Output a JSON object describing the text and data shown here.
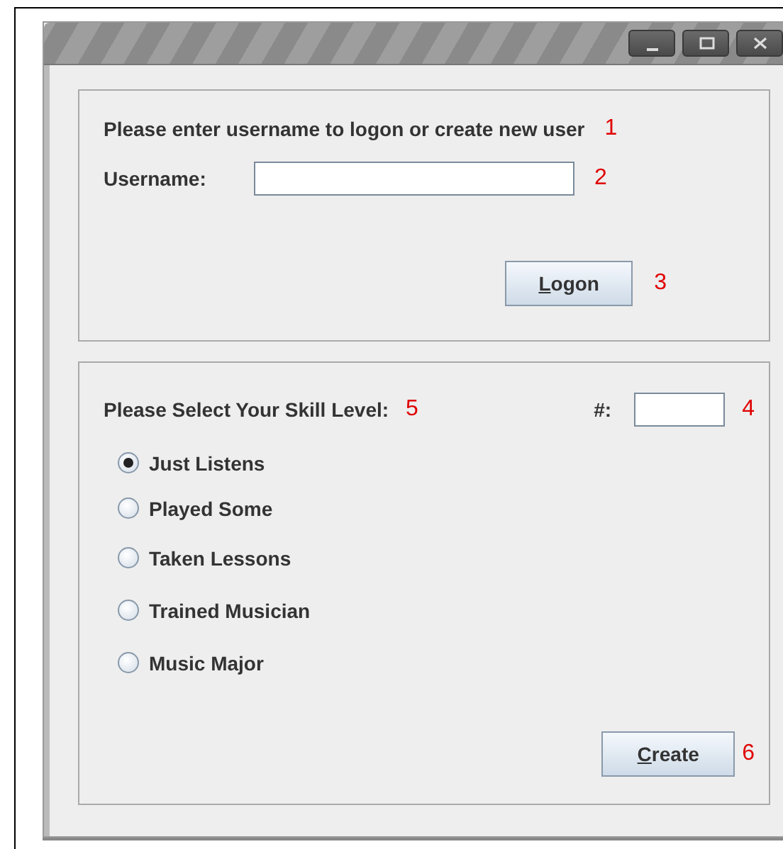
{
  "window": {
    "controls": [
      {
        "kind": "minimize"
      },
      {
        "kind": "maximize"
      },
      {
        "kind": "close"
      }
    ]
  },
  "logon_panel": {
    "prompt": "Please enter username to logon or create new user",
    "prompt_callout": "1",
    "username": {
      "label": "Username:",
      "callout": "2"
    },
    "button": {
      "label": "Logon",
      "underline_first": true,
      "callout": "3"
    }
  },
  "skill_panel": {
    "prompt": "Please Select Your Skill Level:",
    "prompt_callout": "5",
    "number": {
      "label": "#:",
      "callout": "4"
    },
    "options": [
      {
        "label": "Just Listens",
        "selected": true
      },
      {
        "label": "Played Some",
        "selected": false
      },
      {
        "label": "Taken Lessons",
        "selected": false
      },
      {
        "label": "Trained Musician",
        "selected": false
      },
      {
        "label": "Music Major",
        "selected": false
      }
    ],
    "button": {
      "label": "Create",
      "underline_first": true,
      "callout": "6"
    }
  }
}
